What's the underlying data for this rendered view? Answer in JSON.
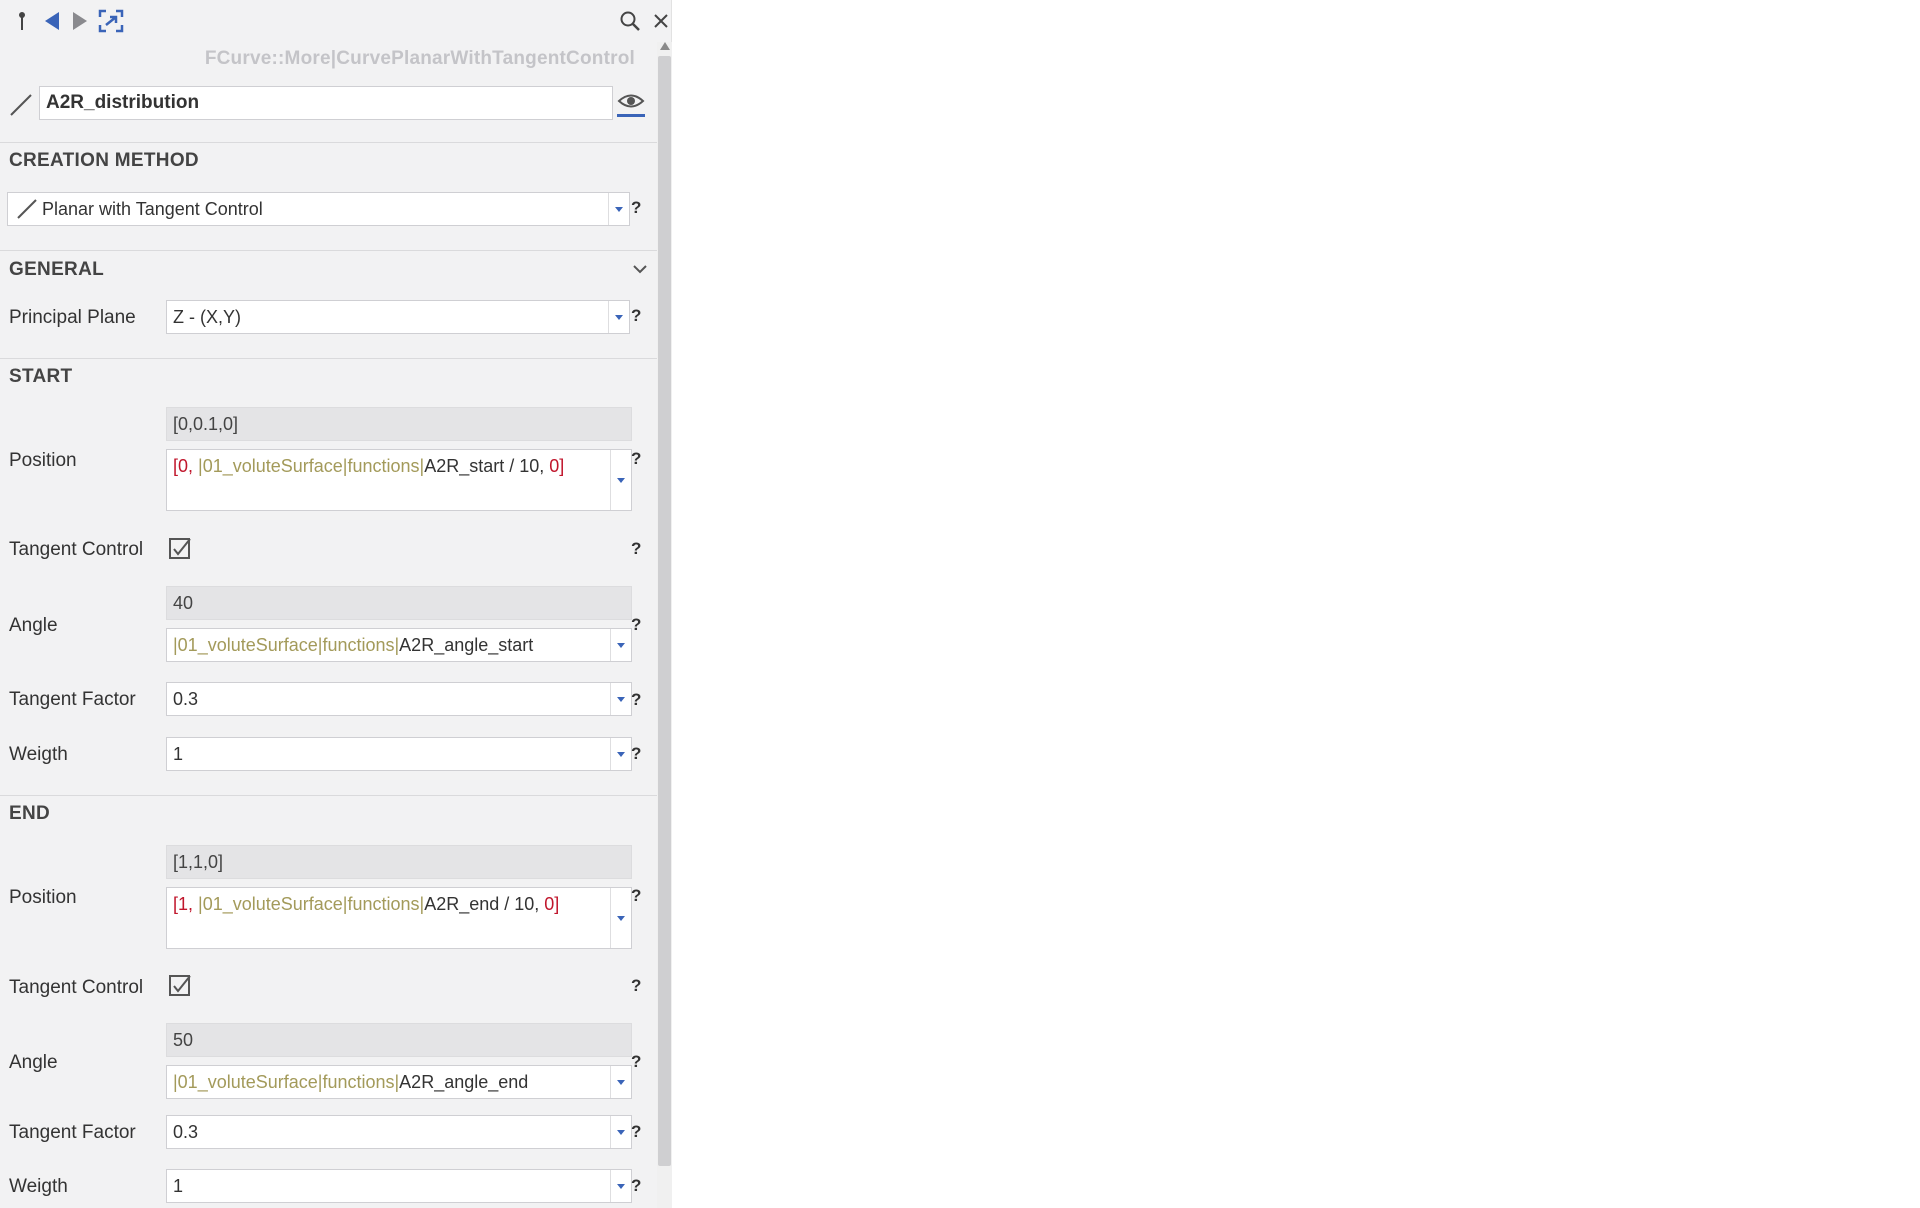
{
  "toolbar": {
    "pin_icon": "pin-icon",
    "back_icon": "back-arrow-icon",
    "forward_icon": "forward-arrow-icon",
    "fit_icon": "fit-view-icon",
    "search_icon": "search-icon",
    "close_icon": "close-icon"
  },
  "header": {
    "type_label": "FCurve::More|CurvePlanarWithTangentControl",
    "name": "A2R_distribution"
  },
  "creation_method": {
    "title": "CREATION METHOD",
    "value": "Planar with Tangent Control",
    "help": "?"
  },
  "general": {
    "title": "GENERAL",
    "principal_plane": {
      "label": "Principal Plane",
      "value": "Z - (X,Y)",
      "help": "?"
    }
  },
  "start": {
    "title": "START",
    "position": {
      "label": "Position",
      "computed": "[0,0.1,0]",
      "expr_open": "[0, ",
      "expr_ref": "|01_voluteSurface|functions|",
      "expr_name": "A2R_start / 10,",
      "expr_close": "0]",
      "help": "?"
    },
    "tangent_control": {
      "label": "Tangent Control",
      "checked": true,
      "help": "?"
    },
    "angle": {
      "label": "Angle",
      "computed": "40",
      "expr_ref": "|01_voluteSurface|functions|",
      "expr_name": "A2R_angle_start",
      "help": "?"
    },
    "tangent_factor": {
      "label": "Tangent Factor",
      "value": "0.3",
      "help": "?"
    },
    "weigth": {
      "label": "Weigth",
      "value": "1",
      "help": "?"
    }
  },
  "end": {
    "title": "END",
    "position": {
      "label": "Position",
      "computed": "[1,1,0]",
      "expr_open": "[1, ",
      "expr_ref": "|01_voluteSurface|functions|",
      "expr_name": "A2R_end / 10,",
      "expr_close": "0]",
      "help": "?"
    },
    "tangent_control": {
      "label": "Tangent Control",
      "checked": true,
      "help": "?"
    },
    "angle": {
      "label": "Angle",
      "computed": "50",
      "expr_ref": "|01_voluteSurface|functions|",
      "expr_name": "A2R_angle_end",
      "help": "?"
    },
    "tangent_factor": {
      "label": "Tangent Factor",
      "value": "0.3",
      "help": "?"
    },
    "weigth": {
      "label": "Weigth",
      "value": "1",
      "help": "?"
    }
  },
  "colors": {
    "accent": "#3a64b8",
    "expression_bracket": "#c0162c",
    "expression_reference": "#a39a5a"
  }
}
